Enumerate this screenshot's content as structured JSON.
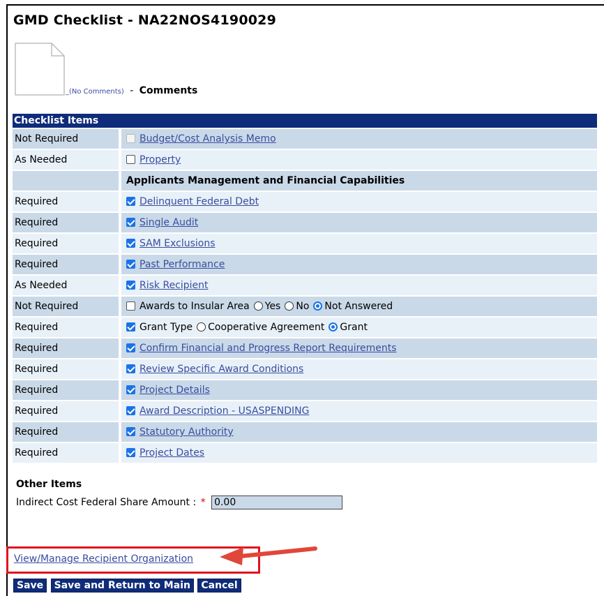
{
  "page": {
    "title": "GMD Checklist - NA22NOS4190029"
  },
  "comments": {
    "link_label": "_(No Comments)",
    "separator": "-",
    "label": "Comments"
  },
  "checklist": {
    "header": "Checklist Items",
    "rows": [
      {
        "requirement": "Not Required",
        "label": "Budget/Cost Analysis Memo",
        "checked": false,
        "disabled": true,
        "link": true
      },
      {
        "requirement": "As Needed",
        "label": "Property",
        "checked": false,
        "link": true
      },
      {
        "requirement": "",
        "section": "Applicants Management and Financial Capabilities"
      },
      {
        "requirement": "Required",
        "label": "Delinquent Federal Debt",
        "checked": true,
        "link": true
      },
      {
        "requirement": "Required",
        "label": "Single Audit",
        "checked": true,
        "link": true
      },
      {
        "requirement": "Required",
        "label": "SAM Exclusions",
        "checked": true,
        "link": true
      },
      {
        "requirement": "Required",
        "label": "Past Performance",
        "checked": true,
        "link": true
      },
      {
        "requirement": "As Needed",
        "label": "Risk Recipient",
        "checked": true,
        "link": true
      },
      {
        "requirement": "Not Required",
        "label": "Awards to Insular Area",
        "checked": false,
        "link": false,
        "radios": [
          {
            "label": "Yes",
            "selected": false
          },
          {
            "label": "No",
            "selected": false
          },
          {
            "label": "Not Answered",
            "selected": true
          }
        ]
      },
      {
        "requirement": "Required",
        "label": "Grant Type",
        "checked": true,
        "link": false,
        "radios": [
          {
            "label": "Cooperative Agreement",
            "selected": false
          },
          {
            "label": "Grant",
            "selected": true
          }
        ]
      },
      {
        "requirement": "Required",
        "label": "Confirm Financial and Progress Report Requirements",
        "checked": true,
        "link": true
      },
      {
        "requirement": "Required",
        "label": "Review Specific Award Conditions",
        "checked": true,
        "link": true
      },
      {
        "requirement": "Required",
        "label": "Project Details",
        "checked": true,
        "link": true
      },
      {
        "requirement": "Required",
        "label": "Award Description - USASPENDING",
        "checked": true,
        "link": true
      },
      {
        "requirement": "Required",
        "label": "Statutory Authority",
        "checked": true,
        "link": true
      },
      {
        "requirement": "Required",
        "label": "Project Dates",
        "checked": true,
        "link": true
      }
    ]
  },
  "other_items": {
    "title": "Other Items",
    "indirect_label": "Indirect Cost Federal Share Amount :",
    "required_mark": "*",
    "indirect_value": "0.00"
  },
  "manage_link": "View/Manage Recipient Organization",
  "buttons": {
    "save": "Save",
    "save_return": "Save and Return to Main",
    "cancel": "Cancel"
  },
  "colors": {
    "header_bg": "#0f2c7a",
    "row_dark": "#c9d9e8",
    "row_light": "#e8f1f8",
    "link": "#3a4da0",
    "highlight": "#e0141e"
  }
}
